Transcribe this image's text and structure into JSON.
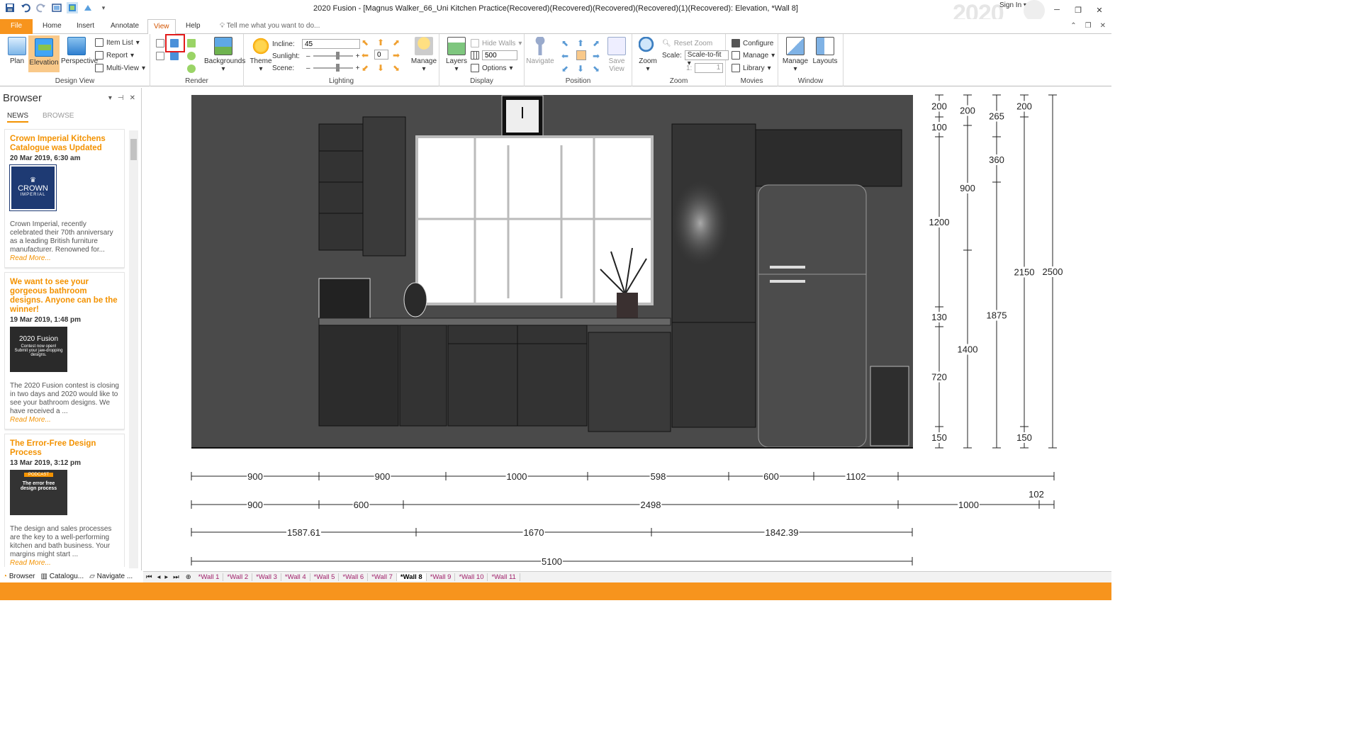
{
  "window": {
    "title": "2020 Fusion - [Magnus Walker_66_Uni Kitchen Practice(Recovered)(Recovered)(Recovered)(Recovered)(1)(Recovered): Elevation, *Wall 8]",
    "sign_in": "Sign In",
    "brand": "2020"
  },
  "menu": {
    "tabs": [
      "File",
      "Home",
      "Insert",
      "Annotate",
      "View",
      "Help"
    ],
    "active": "View",
    "tell_me": "Tell me what you want to do..."
  },
  "ribbon": {
    "design_view": {
      "label": "Design View",
      "plan": "Plan",
      "elevation": "Elevation",
      "perspective": "Perspective",
      "item_list": "Item List",
      "report": "Report",
      "multi_view": "Multi-View"
    },
    "render": {
      "label": "Render",
      "backgrounds": "Backgrounds"
    },
    "lighting": {
      "label": "Lighting",
      "theme": "Theme",
      "incline_label": "Incline:",
      "incline_value": "45",
      "sunlight_label": "Sunlight:",
      "sunlight_value": "0",
      "scene_label": "Scene:",
      "manage": "Manage"
    },
    "display": {
      "label": "Display",
      "layers": "Layers",
      "hide_walls": "Hide Walls",
      "value": "500",
      "options": "Options"
    },
    "position": {
      "label": "Position",
      "navigate": "Navigate",
      "save_view": "Save View"
    },
    "zoom": {
      "label": "Zoom",
      "zoom": "Zoom",
      "reset_zoom": "Reset Zoom",
      "scale_label": "Scale:",
      "scale_value": "Scale-to-fit",
      "ratio_a": "1:",
      "ratio_b": "1"
    },
    "movies": {
      "label": "Movies",
      "configure": "Configure",
      "manage": "Manage",
      "library": "Library"
    },
    "window": {
      "label": "Window",
      "manage": "Manage",
      "layouts": "Layouts"
    }
  },
  "browser": {
    "title": "Browser",
    "tabs": [
      "NEWS",
      "BROWSE"
    ],
    "news": [
      {
        "title": "Crown Imperial Kitchens Catalogue was Updated",
        "date": "20 Mar 2019, 6:30 am",
        "logo_text": "CROWN",
        "logo_sub": "IMPERIAL",
        "body": "Crown Imperial, recently celebrated their 70th anniversary as a leading British furniture manufacturer. Renowned for...",
        "more": "Read More..."
      },
      {
        "title": "We want to see your gorgeous bathroom designs. Anyone can be the winner!",
        "date": "19 Mar 2019, 1:48 pm",
        "logo_text": "2020 Fusion",
        "logo_sub": "Contest now open! Submit your jaw-dropping designs.",
        "body": "The 2020 Fusion contest is closing in two days and 2020 would like to see your bathroom designs. We have received a ...",
        "more": "Read More..."
      },
      {
        "title": "The Error-Free Design Process",
        "date": "13 Mar 2019, 3:12 pm",
        "logo_text": "PODCAST",
        "logo_sub": "The error free design process",
        "body": "The design and sales processes are the key to a well-performing kitchen and bath business. Your margins might start ...",
        "more": "Read More..."
      }
    ],
    "bottom_tabs": [
      "Browser",
      "Catalogu...",
      "Navigate ..."
    ]
  },
  "dims": {
    "row1": [
      "900",
      "900",
      "1000",
      "598",
      "600",
      "1102"
    ],
    "row2": [
      "900",
      "600",
      "2498",
      "1000"
    ],
    "row2_extra": "102",
    "row3": [
      "1587.61",
      "1670",
      "1842.39"
    ],
    "row4": [
      "5100"
    ],
    "v1": [
      "200",
      "100",
      "1200",
      "130",
      "720",
      "150"
    ],
    "v2": [
      "200",
      "900",
      "1400"
    ],
    "v3": [
      "265",
      "360",
      "1875"
    ],
    "v4": [
      "200",
      "2150",
      "150"
    ],
    "v5": [
      "2500"
    ]
  },
  "walls": [
    "*Wall 1",
    "*Wall 2",
    "*Wall 3",
    "*Wall 4",
    "*Wall 5",
    "*Wall 6",
    "*Wall 7",
    "*Wall 8",
    "*Wall 9",
    "*Wall 10",
    "*Wall 11"
  ],
  "active_wall": "*Wall 8",
  "colors": {
    "accent": "#f7941d",
    "news_title": "#f39200",
    "wall_tab": "#a0206b",
    "highlight": "#e21b1b"
  }
}
